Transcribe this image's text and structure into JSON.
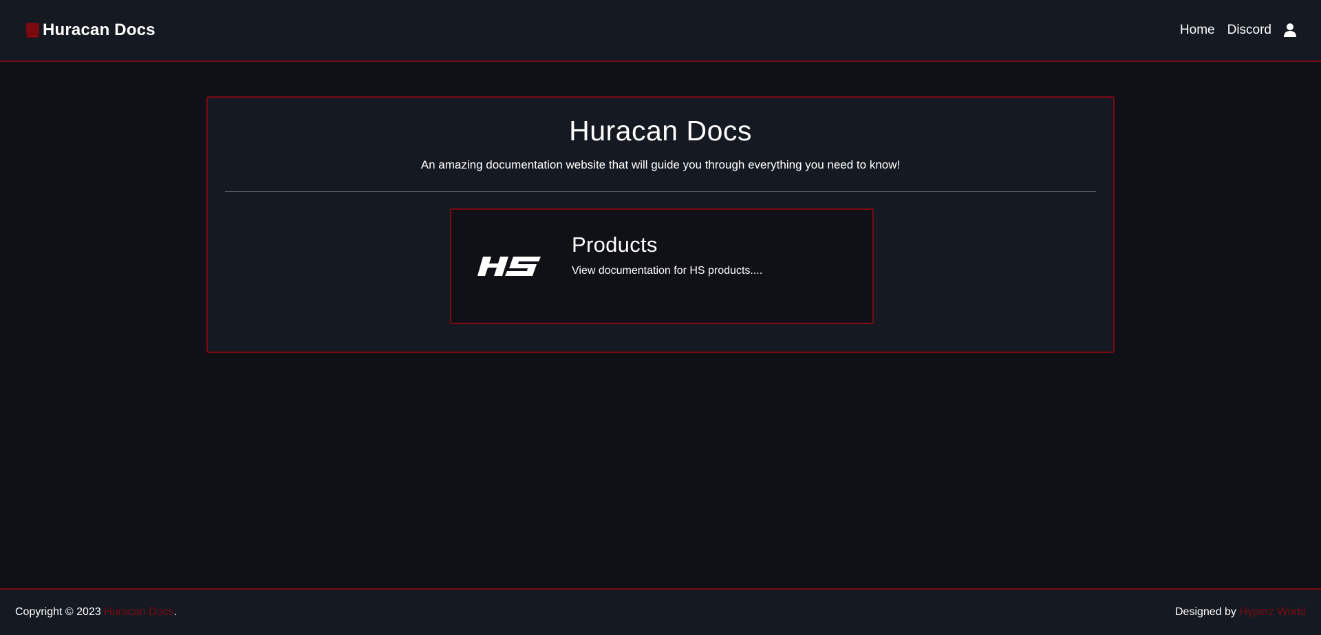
{
  "colors": {
    "background": "#101117",
    "surface": "#151a22",
    "accent": "#7a0a0f",
    "text": "#ffffff"
  },
  "navbar": {
    "brand_icon": "book-icon",
    "brand_text": "Huracan Docs",
    "links": [
      {
        "label": "Home"
      },
      {
        "label": "Discord"
      }
    ],
    "user_icon": "user-icon"
  },
  "hero": {
    "title": "Huracan Docs",
    "subtitle": "An amazing documentation website that will guide you through everything you need to know!"
  },
  "cards": [
    {
      "logo": "hs-logo",
      "title": "Products",
      "description": "View documentation for HS products...."
    }
  ],
  "footer": {
    "copyright_prefix": "Copyright © 2023 ",
    "copyright_link": "Huracan Docs",
    "copyright_suffix": ".",
    "designed_prefix": "Designed by ",
    "designed_link": "Hyperz World"
  }
}
